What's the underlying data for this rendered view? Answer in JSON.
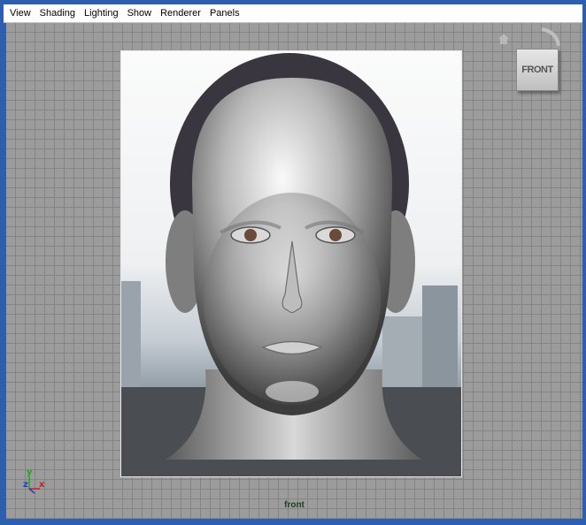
{
  "menubar": {
    "items": [
      {
        "label": "View"
      },
      {
        "label": "Shading"
      },
      {
        "label": "Lighting"
      },
      {
        "label": "Show"
      },
      {
        "label": "Renderer"
      },
      {
        "label": "Panels"
      }
    ]
  },
  "viewcube": {
    "face_label": "FRONT"
  },
  "viewport": {
    "camera_label": "front"
  },
  "axes": {
    "y": "y",
    "z": "z",
    "x": "x"
  },
  "colors": {
    "window_border": "#2d5fb0",
    "grid_background": "#9c9c9c",
    "grid_lines": "#848484",
    "axis_x": "#d11d1d",
    "axis_y": "#1da81d",
    "axis_z": "#1d3fd1",
    "camera_label": "#1c3f1c"
  }
}
